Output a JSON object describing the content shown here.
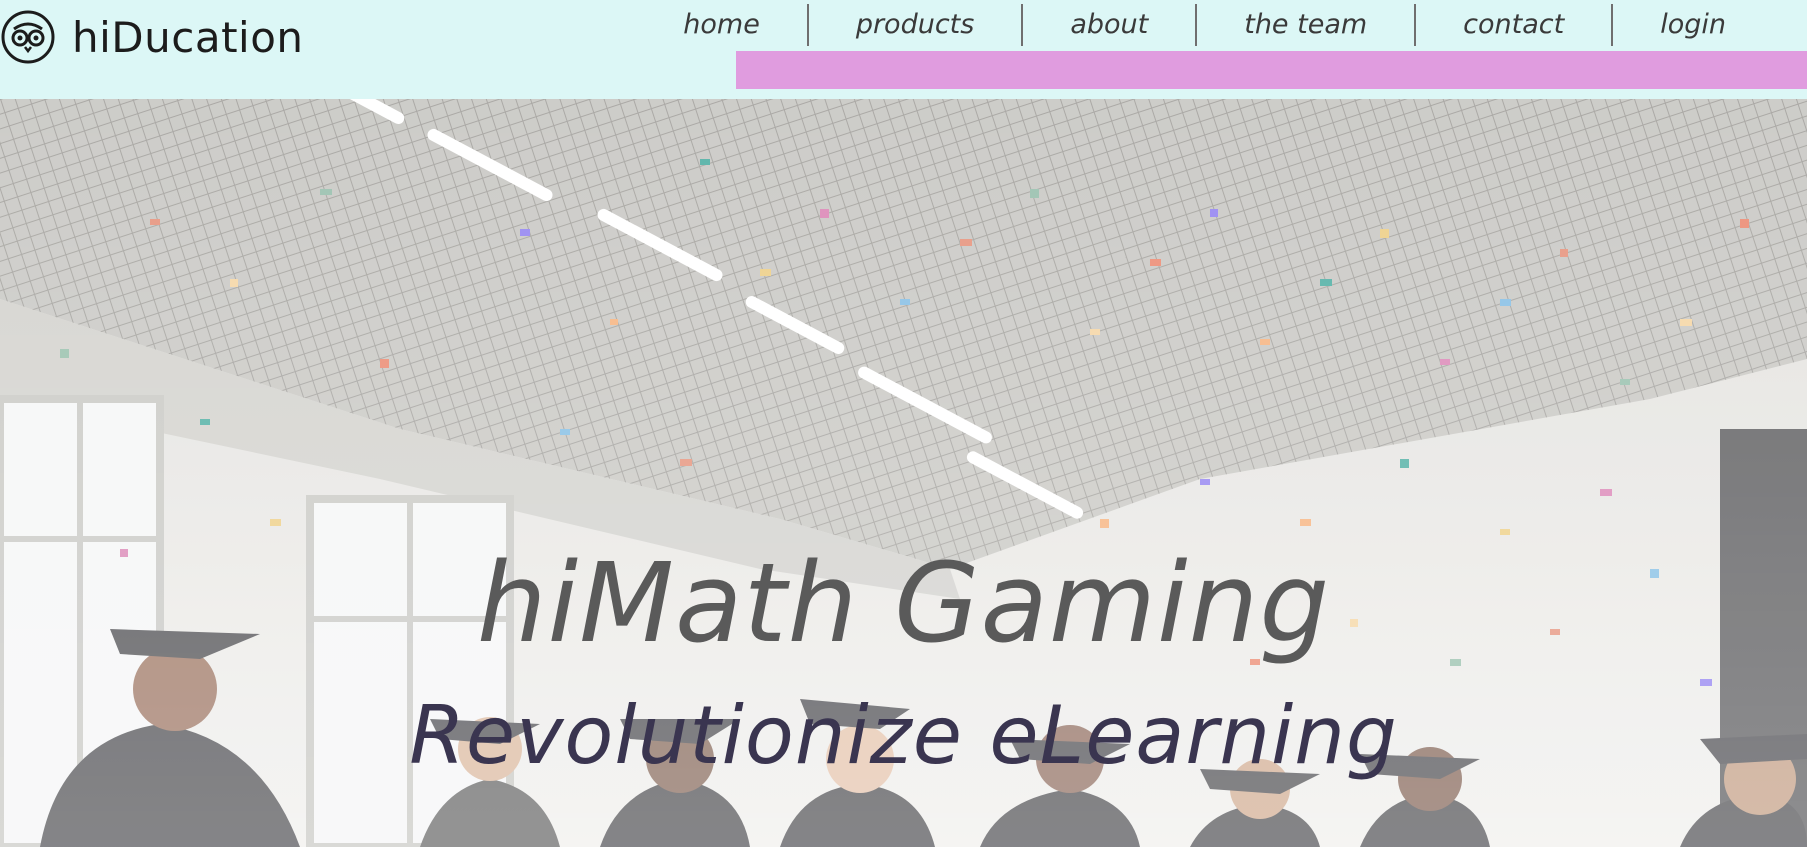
{
  "brand": {
    "name": "hiDucation",
    "logo_icon": "owl-face-icon"
  },
  "nav": {
    "items": [
      {
        "label": "home"
      },
      {
        "label": "products"
      },
      {
        "label": "about"
      },
      {
        "label": "the team"
      },
      {
        "label": "contact"
      },
      {
        "label": "login"
      }
    ]
  },
  "hero": {
    "title": "hiMath Gaming",
    "subtitle": "Revolutionize eLearning",
    "image": "graduation-celebration-photo"
  },
  "colors": {
    "header_bg": "#dcf7f6",
    "nav_accent_bar": "#e09cdf",
    "title_text": "#5a5a5a",
    "subtitle_text": "#3a3550"
  }
}
